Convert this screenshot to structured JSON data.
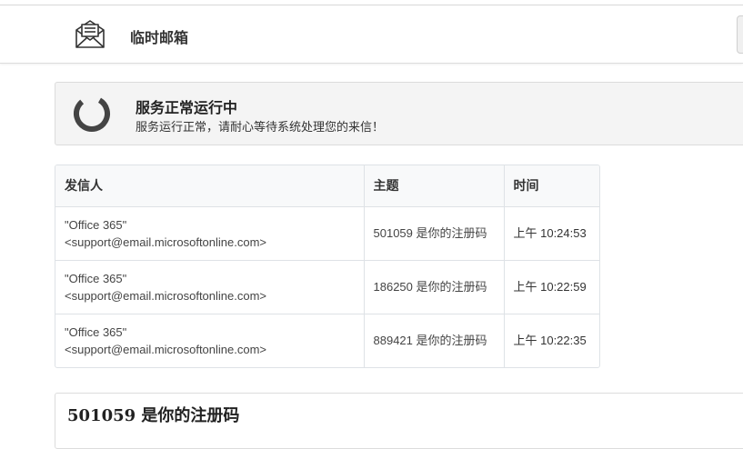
{
  "navbar": {
    "brand": "临时邮箱",
    "logo_icon": "envelope-letter-icon"
  },
  "status": {
    "title": "服务正常运行中",
    "description": "服务运行正常，请耐心等待系统处理您的来信！",
    "icon": "loading-spinner-icon"
  },
  "table": {
    "headers": {
      "sender": "发信人",
      "subject": "主题",
      "time": "时间"
    },
    "rows": [
      {
        "sender_name": "\"Office 365\"",
        "sender_email": "<support@email.microsoftonline.com>",
        "subject": "501059 是你的注册码",
        "time": "上午 10:24:53"
      },
      {
        "sender_name": "\"Office 365\"",
        "sender_email": "<support@email.microsoftonline.com>",
        "subject": "186250 是你的注册码",
        "time": "上午 10:22:59"
      },
      {
        "sender_name": "\"Office 365\"",
        "sender_email": "<support@email.microsoftonline.com>",
        "subject": "889421 是你的注册码",
        "time": "上午 10:22:35"
      }
    ]
  },
  "email_view": {
    "title": "501059 是你的注册码"
  }
}
